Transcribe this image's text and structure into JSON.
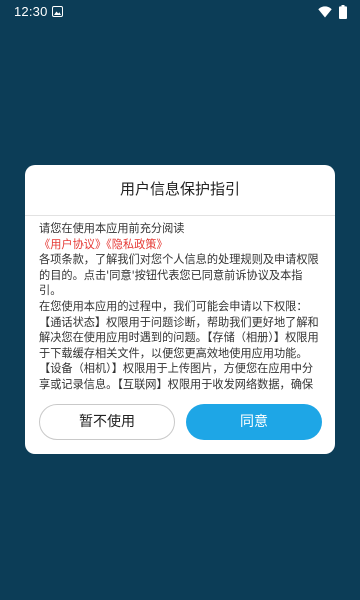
{
  "status_bar": {
    "time": "12:30",
    "icons": [
      "app-notification-icon",
      "wifi-icon",
      "battery-icon"
    ]
  },
  "colors": {
    "background": "#0c3d57",
    "link": "#e53935",
    "accent": "#1ea6e6"
  },
  "dialog": {
    "title": "用户信息保护指引",
    "intro": "请您在使用本应用前充分阅读",
    "links": {
      "user_agreement": "《用户协议》",
      "privacy_policy": "《隐私政策》"
    },
    "paragraph_1": "各项条款，了解我们对您个人信息的处理规则及申请权限的目的。点击'同意'按钮代表您已同意前诉协议及本指引。",
    "paragraph_2": "在您使用本应用的过程中，我们可能会申请以下权限：【通话状态】权限用于问题诊断，帮助我们更好地了解和解决您在使用应用时遇到的问题。【存储（相册）】权限用于下载缓存相关文件，以便您更高效地使用应用功能。【设备（相机）】权限用于上传图片，方便您在应用中分享或记录信息。【互联网】权限用于收发网络数据，确保",
    "decline_label": "暂不使用",
    "agree_label": "同意"
  }
}
